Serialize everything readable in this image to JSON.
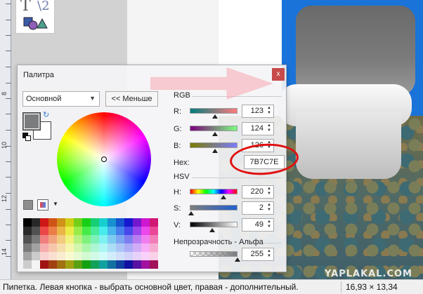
{
  "toolbox": {
    "glyph_text": "T",
    "glyph_curve": "\\2"
  },
  "ruler": {
    "labels": [
      "8",
      "10",
      "12",
      "14"
    ]
  },
  "palette": {
    "title": "Палитра",
    "close_label": "x",
    "mode_select_value": "Основной",
    "less_button_label": "<< Меньше",
    "primary_color": "#7B7C7E",
    "secondary_color": "#FFFFFF",
    "rgb": {
      "section_label": "RGB",
      "r_label": "R:",
      "g_label": "G:",
      "b_label": "B:",
      "r_value": "123",
      "g_value": "124",
      "b_value": "126",
      "hex_label": "Hex:",
      "hex_value": "7B7C7E"
    },
    "hsv": {
      "section_label": "HSV",
      "h_label": "H:",
      "s_label": "S:",
      "v_label": "V:",
      "h_value": "220",
      "s_value": "2",
      "v_value": "49"
    },
    "alpha": {
      "section_label": "Непрозрачность - Альфа",
      "value": "255"
    }
  },
  "status": {
    "hint": "Пипетка. Левая кнопка - выбрать основной цвет, правая - дополнительный.",
    "size": "16,93 × 13,34"
  },
  "watermark": "YAPLAKAL.COM"
}
